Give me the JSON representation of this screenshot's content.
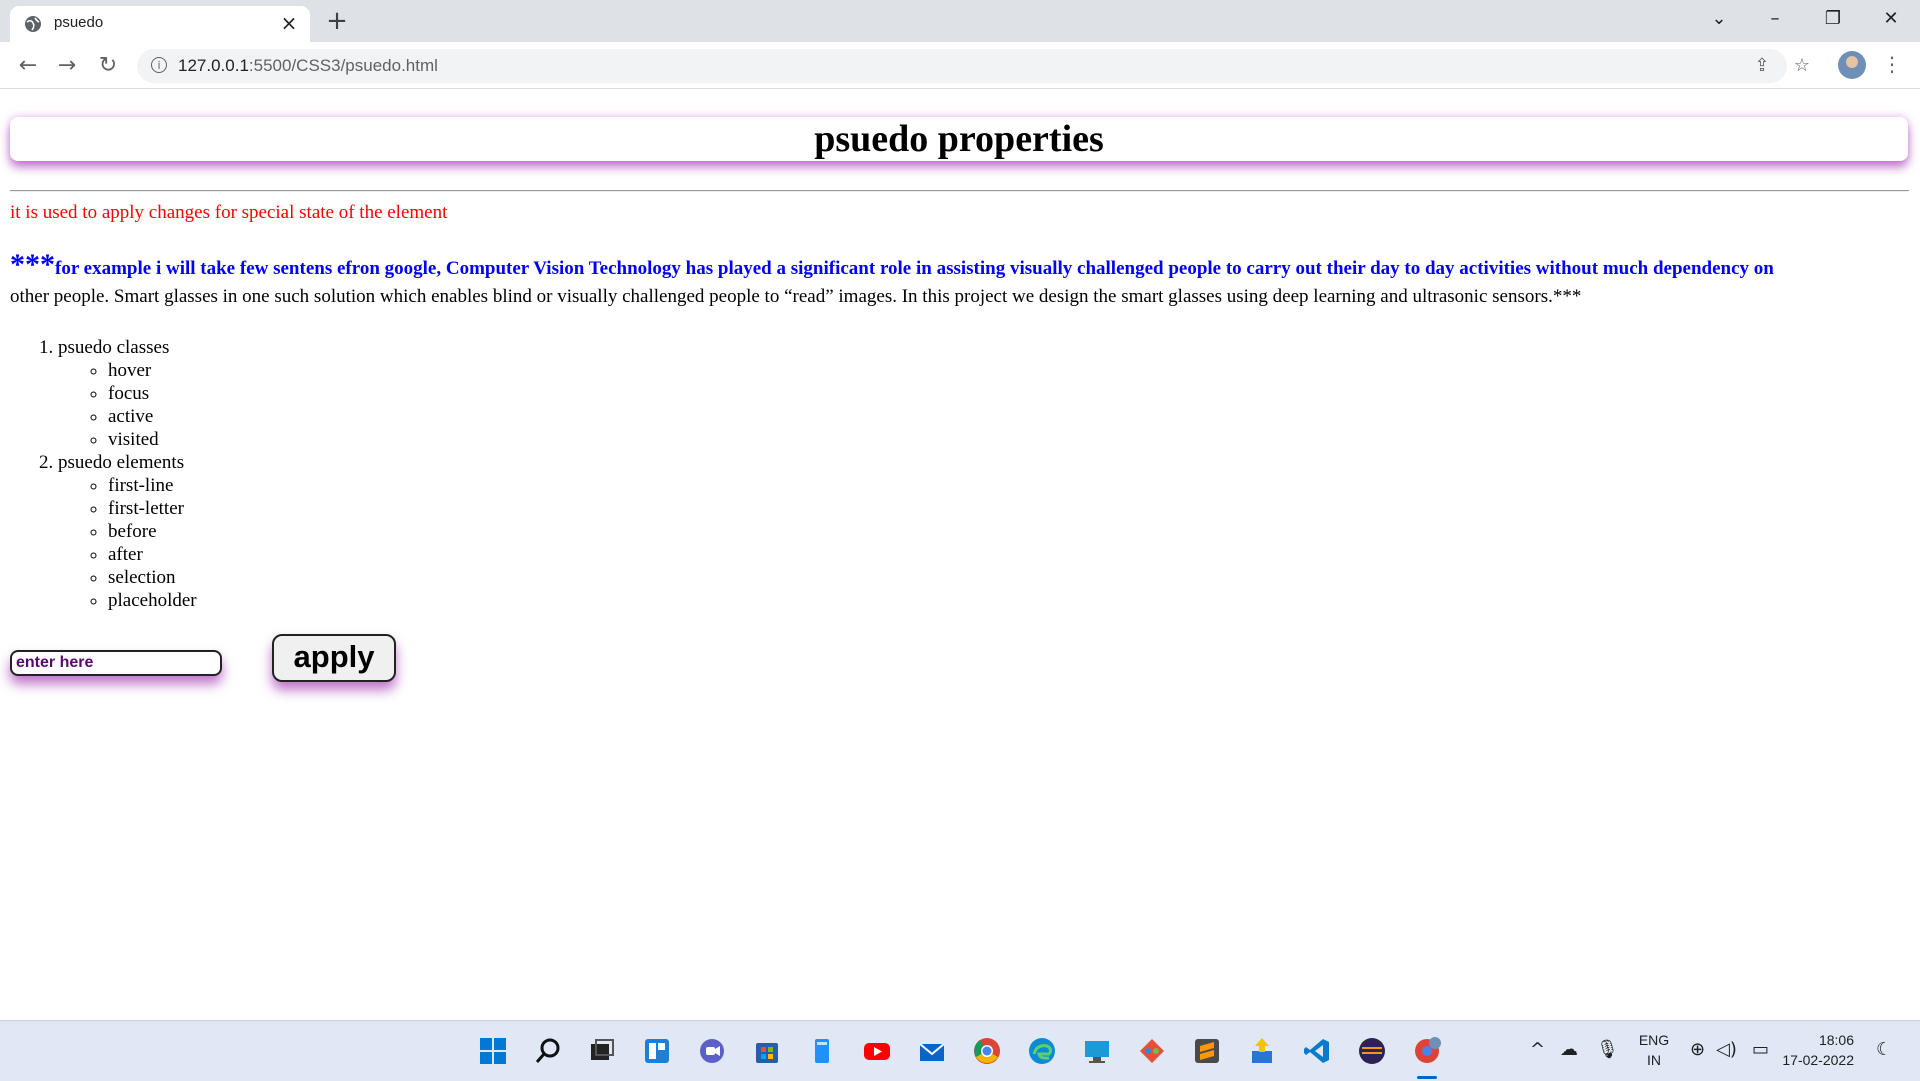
{
  "browser": {
    "tab_title": "psuedo",
    "url_host": "127.0.0.1",
    "url_rest": ":5500/CSS3/psuedo.html"
  },
  "page": {
    "heading": "psuedo properties",
    "description": "it is used to apply changes for special state of the element",
    "paragraph": {
      "stars_open": "***",
      "first_line": "for example i will take few sentens efron google, Computer Vision Technology has played a significant role in assisting visually challenged people to carry out their day to day activities without much dependency on",
      "rest": "other people. Smart glasses in one such solution which enables blind or visually challenged people to “read” images. In this project we design the smart glasses using deep learning and ultrasonic sensors.***"
    },
    "list": {
      "items": [
        {
          "label": "psuedo classes",
          "children": [
            "hover",
            "focus",
            "active",
            "visited"
          ]
        },
        {
          "label": "psuedo elements",
          "children": [
            "first-line",
            "first-letter",
            "before",
            "after",
            "selection",
            "placeholder"
          ]
        }
      ]
    },
    "form": {
      "placeholder": "enter here",
      "button_label": "apply"
    }
  },
  "taskbar": {
    "lang_top": "ENG",
    "lang_bottom": "IN",
    "time": "18:06",
    "date": "17-02-2022",
    "icons": [
      "windows-start-icon",
      "search-icon",
      "task-view-icon",
      "widgets-icon",
      "chat-icon",
      "store-icon",
      "file-explorer-icon",
      "youtube-icon",
      "mail-icon",
      "chrome-icon",
      "edge-icon",
      "remote-desktop-icon",
      "git-icon",
      "sublime-icon",
      "installer-icon",
      "vscode-icon",
      "eclipse-icon",
      "chrome-profile-icon"
    ]
  },
  "colors": {
    "accent_red": "#ff0000",
    "accent_blue": "#0000ff",
    "shadow_purple": "#8c00a0"
  }
}
